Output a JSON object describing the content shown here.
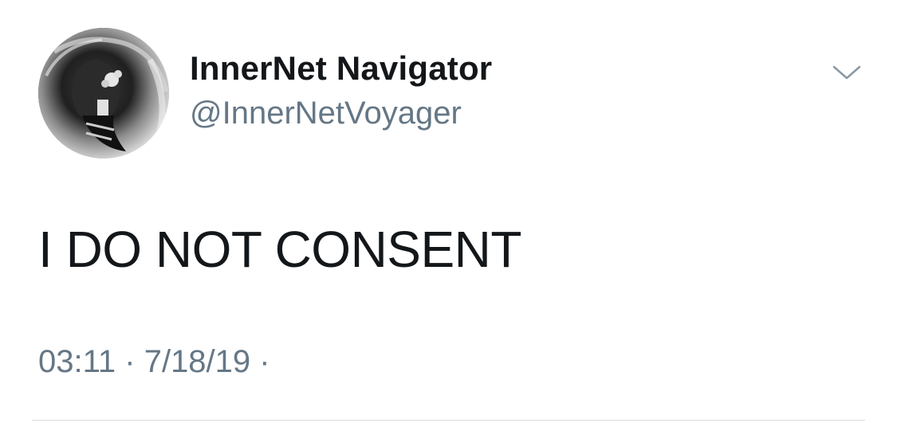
{
  "tweet": {
    "display_name": "InnerNet Navigator",
    "handle": "@InnerNetVoyager",
    "text": "I DO NOT CONSENT",
    "time": "03:11",
    "date": "7/18/19",
    "separator": "·"
  },
  "icons": {
    "menu": "chevron-down-icon",
    "avatar": "avatar"
  },
  "colors": {
    "name": "#14171a",
    "secondary": "#657786",
    "divider": "#d6dadd"
  }
}
